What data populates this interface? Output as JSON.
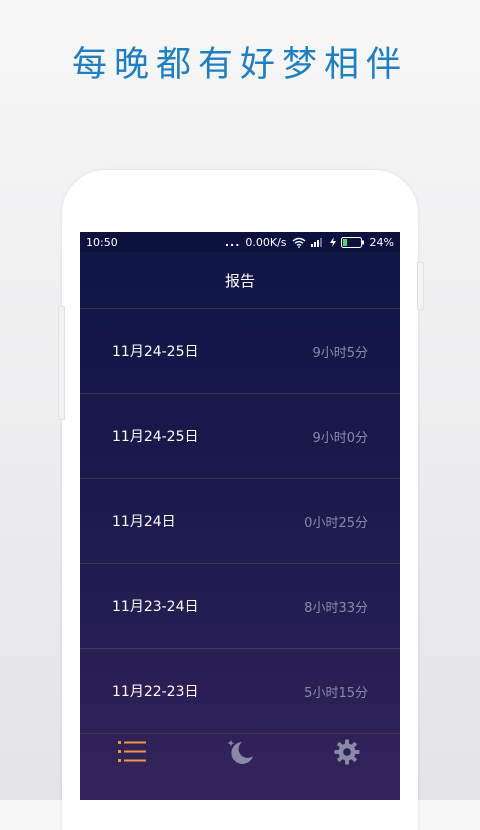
{
  "headline": "每晚都有好梦相伴",
  "status_bar": {
    "time": "10:50",
    "dots": "...",
    "network_speed": "0.00K/s",
    "battery_percent": "24%",
    "battery_level": 0.24
  },
  "screen": {
    "title": "报告"
  },
  "reports": [
    {
      "date": "11月24-25日",
      "duration": "9小时5分"
    },
    {
      "date": "11月24-25日",
      "duration": "9小时0分"
    },
    {
      "date": "11月24日",
      "duration": "0小时25分"
    },
    {
      "date": "11月23-24日",
      "duration": "8小时33分"
    },
    {
      "date": "11月22-23日",
      "duration": "5小时15分"
    }
  ],
  "tabs": [
    {
      "id": "reports",
      "icon": "list-icon",
      "active": true
    },
    {
      "id": "sleep",
      "icon": "moon-stars-icon",
      "active": false
    },
    {
      "id": "settings",
      "icon": "gear-icon",
      "active": false
    }
  ],
  "colors": {
    "headline": "#1f7fc4",
    "active_tab": "#f0973a",
    "inactive_tab": "#8a8aa8",
    "battery_fill": "#4cd964"
  }
}
